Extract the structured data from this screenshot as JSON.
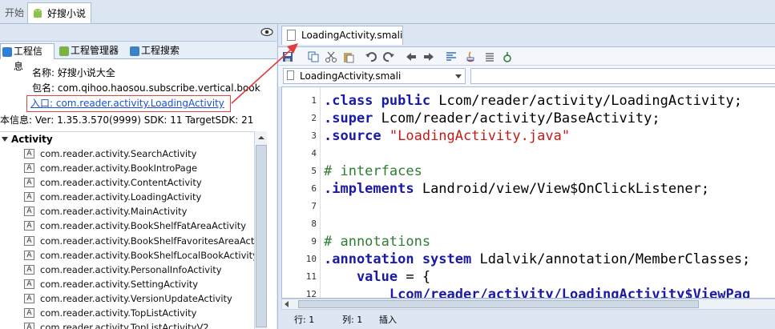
{
  "top_tabs": {
    "start": "开始",
    "project": "好搜小说"
  },
  "left_tabs": [
    "工程信息",
    "工程管理器",
    "工程搜索"
  ],
  "info": {
    "name": "名称:  好搜小说大全",
    "package": "包名:  com.qihoo.haosou.subscribe.vertical.book",
    "entry": "入口:  com.reader.activity.LoadingActivity",
    "version": "本信息:  Ver:  1.35.3.570(9999)  SDK:  11  TargetSDK:  21"
  },
  "tree": {
    "header": "Activity",
    "items": [
      "com.reader.activity.SearchActivity",
      "com.reader.activity.BookIntroPage",
      "com.reader.activity.ContentActivity",
      "com.reader.activity.LoadingActivity",
      "com.reader.activity.MainActivity",
      "com.reader.activity.BookShelfFatAreaActivity",
      "com.reader.activity.BookShelfFavoritesAreaActivity",
      "com.reader.activity.BookShelfLocalBookActivity",
      "com.reader.activity.PersonalInfoActivity",
      "com.reader.activity.SettingActivity",
      "com.reader.activity.VersionUpdateActivity",
      "com.reader.activity.TopListActivity",
      "com.reader.activity.TopListActivityV2"
    ]
  },
  "editor": {
    "file_tab": "LoadingActivity.smali",
    "combo_value": "LoadingActivity.smali",
    "line_numbers": [
      "1",
      "2",
      "3",
      "4",
      "5",
      "6",
      "7",
      "8",
      "9",
      "10",
      "11",
      "12"
    ],
    "lines": [
      [
        {
          "t": ".class public ",
          "c": "kw"
        },
        {
          "t": "Lcom/reader/activity/LoadingActivity;",
          "c": ""
        }
      ],
      [
        {
          "t": ".super ",
          "c": "kw"
        },
        {
          "t": "Lcom/reader/activity/BaseActivity;",
          "c": ""
        }
      ],
      [
        {
          "t": ".source ",
          "c": "kw"
        },
        {
          "t": "\"LoadingActivity.java\"",
          "c": "str"
        }
      ],
      [],
      [
        {
          "t": "# interfaces",
          "c": "cmt"
        }
      ],
      [
        {
          "t": ".implements ",
          "c": "kw"
        },
        {
          "t": "Landroid/view/View$OnClickListener;",
          "c": ""
        }
      ],
      [],
      [],
      [
        {
          "t": "# annotations",
          "c": "cmt"
        }
      ],
      [
        {
          "t": ".annotation system ",
          "c": "kw"
        },
        {
          "t": "Ldalvik/annotation/MemberClasses;",
          "c": ""
        }
      ],
      [
        {
          "t": "    value ",
          "c": "kw"
        },
        {
          "t": "= {",
          "c": ""
        }
      ],
      [
        {
          "t": "        Lcom/reader/activity/LoadingActivity$ViewPag",
          "c": "kw"
        }
      ]
    ]
  },
  "status": {
    "row": "行: 1",
    "col": "列: 1",
    "mode": "插入"
  },
  "colors": {
    "accent": "#1a1aa6",
    "string": "#c41a16",
    "comment": "#2e7d32",
    "highlight_box": "#dd4444"
  }
}
